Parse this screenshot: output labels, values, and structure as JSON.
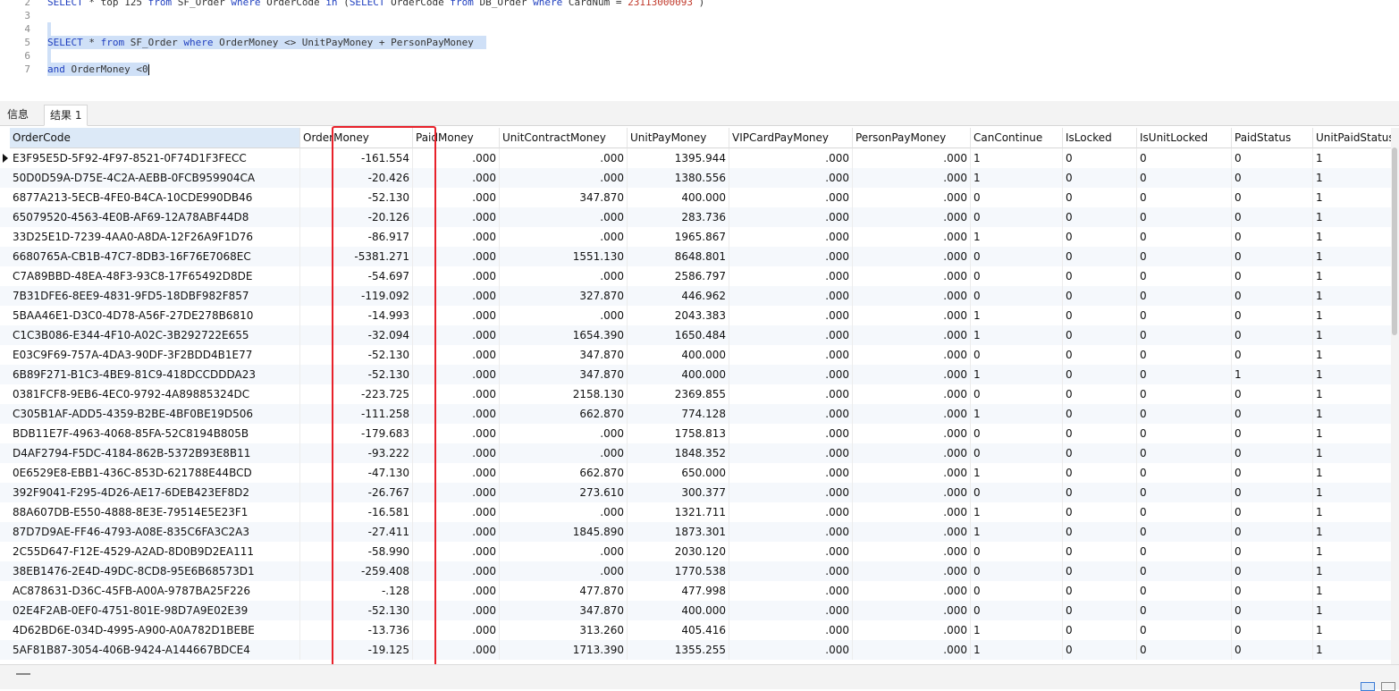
{
  "editor": {
    "lines": [
      {
        "num": "2",
        "tokens": [
          {
            "t": "SELECT ",
            "c": "kw"
          },
          {
            "t": "* top 125 ",
            "c": "plain"
          },
          {
            "t": "from ",
            "c": "kw"
          },
          {
            "t": "SF_Order ",
            "c": "plain"
          },
          {
            "t": "where ",
            "c": "kw"
          },
          {
            "t": "OrderCode ",
            "c": "plain"
          },
          {
            "t": "in ",
            "c": "kw"
          },
          {
            "t": "(",
            "c": "plain"
          },
          {
            "t": "SELECT ",
            "c": "kw"
          },
          {
            "t": "OrderCode ",
            "c": "plain"
          },
          {
            "t": "from ",
            "c": "kw"
          },
          {
            "t": "DB_Order ",
            "c": "plain"
          },
          {
            "t": "where ",
            "c": "kw"
          },
          {
            "t": "CardNum = ",
            "c": "plain"
          },
          {
            "t": "23113000093",
            "c": "num"
          },
          {
            "t": " )",
            "c": "plain"
          }
        ]
      },
      {
        "num": "3",
        "tokens": []
      },
      {
        "num": "4",
        "tokens": [],
        "selected": true
      },
      {
        "num": "5",
        "tokens": [
          {
            "t": "SELECT ",
            "c": "kw"
          },
          {
            "t": "* ",
            "c": "plain"
          },
          {
            "t": "from ",
            "c": "kw"
          },
          {
            "t": "SF_Order ",
            "c": "plain"
          },
          {
            "t": "where ",
            "c": "kw"
          },
          {
            "t": "OrderMoney <> UnitPayMoney + PersonPayMoney",
            "c": "plain"
          }
        ],
        "selected": true
      },
      {
        "num": "6",
        "tokens": [],
        "selected": true
      },
      {
        "num": "7",
        "tokens": [
          {
            "t": "and ",
            "c": "kw"
          },
          {
            "t": "OrderMoney <0",
            "c": "plain"
          }
        ],
        "selected": true,
        "caret": true
      }
    ]
  },
  "tabs": [
    {
      "label": "信息",
      "active": false
    },
    {
      "label": "结果 1",
      "active": true
    }
  ],
  "grid": {
    "columns": [
      "OrderCode",
      "OrderMoney",
      "PaidMoney",
      "UnitContractMoney",
      "UnitPayMoney",
      "VIPCardPayMoney",
      "PersonPayMoney",
      "CanContinue",
      "IsLocked",
      "IsUnitLocked",
      "PaidStatus",
      "UnitPaidStatus"
    ],
    "rows": [
      [
        "E3F95E5D-5F92-4F97-8521-0F74D1F3FECC",
        "-161.554",
        ".000",
        ".000",
        "1395.944",
        ".000",
        ".000",
        "1",
        "0",
        "0",
        "0",
        "1"
      ],
      [
        "50D0D59A-D75E-4C2A-AEBB-0FCB959904CA",
        "-20.426",
        ".000",
        ".000",
        "1380.556",
        ".000",
        ".000",
        "1",
        "0",
        "0",
        "0",
        "1"
      ],
      [
        "6877A213-5ECB-4FE0-B4CA-10CDE990DB46",
        "-52.130",
        ".000",
        "347.870",
        "400.000",
        ".000",
        ".000",
        "0",
        "0",
        "0",
        "0",
        "1"
      ],
      [
        "65079520-4563-4E0B-AF69-12A78ABF44D8",
        "-20.126",
        ".000",
        ".000",
        "283.736",
        ".000",
        ".000",
        "0",
        "0",
        "0",
        "0",
        "1"
      ],
      [
        "33D25E1D-7239-4AA0-A8DA-12F26A9F1D76",
        "-86.917",
        ".000",
        ".000",
        "1965.867",
        ".000",
        ".000",
        "1",
        "0",
        "0",
        "0",
        "1"
      ],
      [
        "6680765A-CB1B-47C7-8DB3-16F76E7068EC",
        "-5381.271",
        ".000",
        "1551.130",
        "8648.801",
        ".000",
        ".000",
        "0",
        "0",
        "0",
        "0",
        "1"
      ],
      [
        "C7A89BBD-48EA-48F3-93C8-17F65492D8DE",
        "-54.697",
        ".000",
        ".000",
        "2586.797",
        ".000",
        ".000",
        "0",
        "0",
        "0",
        "0",
        "1"
      ],
      [
        "7B31DFE6-8EE9-4831-9FD5-18DBF982F857",
        "-119.092",
        ".000",
        "327.870",
        "446.962",
        ".000",
        ".000",
        "0",
        "0",
        "0",
        "0",
        "1"
      ],
      [
        "5BAA46E1-D3C0-4D78-A56F-27DE278B6810",
        "-14.993",
        ".000",
        ".000",
        "2043.383",
        ".000",
        ".000",
        "1",
        "0",
        "0",
        "0",
        "1"
      ],
      [
        "C1C3B086-E344-4F10-A02C-3B292722E655",
        "-32.094",
        ".000",
        "1654.390",
        "1650.484",
        ".000",
        ".000",
        "1",
        "0",
        "0",
        "0",
        "1"
      ],
      [
        "E03C9F69-757A-4DA3-90DF-3F2BDD4B1E77",
        "-52.130",
        ".000",
        "347.870",
        "400.000",
        ".000",
        ".000",
        "0",
        "0",
        "0",
        "0",
        "1"
      ],
      [
        "6B89F271-B1C3-4BE9-81C9-418DCCDDDA23",
        "-52.130",
        ".000",
        "347.870",
        "400.000",
        ".000",
        ".000",
        "1",
        "0",
        "0",
        "1",
        "1"
      ],
      [
        "0381FCF8-9EB6-4EC0-9792-4A89885324DC",
        "-223.725",
        ".000",
        "2158.130",
        "2369.855",
        ".000",
        ".000",
        "0",
        "0",
        "0",
        "0",
        "1"
      ],
      [
        "C305B1AF-ADD5-4359-B2BE-4BF0BE19D506",
        "-111.258",
        ".000",
        "662.870",
        "774.128",
        ".000",
        ".000",
        "1",
        "0",
        "0",
        "0",
        "1"
      ],
      [
        "BDB11E7F-4963-4068-85FA-52C8194B805B",
        "-179.683",
        ".000",
        ".000",
        "1758.813",
        ".000",
        ".000",
        "0",
        "0",
        "0",
        "0",
        "1"
      ],
      [
        "D4AF2794-F5DC-4184-862B-5372B93E8B11",
        "-93.222",
        ".000",
        ".000",
        "1848.352",
        ".000",
        ".000",
        "0",
        "0",
        "0",
        "0",
        "1"
      ],
      [
        "0E6529E8-EBB1-436C-853D-621788E44BCD",
        "-47.130",
        ".000",
        "662.870",
        "650.000",
        ".000",
        ".000",
        "1",
        "0",
        "0",
        "0",
        "1"
      ],
      [
        "392F9041-F295-4D26-AE17-6DEB423EF8D2",
        "-26.767",
        ".000",
        "273.610",
        "300.377",
        ".000",
        ".000",
        "0",
        "0",
        "0",
        "0",
        "1"
      ],
      [
        "88A607DB-E550-4888-8E3E-79514E5E23F1",
        "-16.581",
        ".000",
        ".000",
        "1321.711",
        ".000",
        ".000",
        "1",
        "0",
        "0",
        "0",
        "1"
      ],
      [
        "87D7D9AE-FF46-4793-A08E-835C6FA3C2A3",
        "-27.411",
        ".000",
        "1845.890",
        "1873.301",
        ".000",
        ".000",
        "1",
        "0",
        "0",
        "0",
        "1"
      ],
      [
        "2C55D647-F12E-4529-A2AD-8D0B9D2EA111",
        "-58.990",
        ".000",
        ".000",
        "2030.120",
        ".000",
        ".000",
        "0",
        "0",
        "0",
        "0",
        "1"
      ],
      [
        "38EB1476-2E4D-49DC-8CD8-95E6B68573D1",
        "-259.408",
        ".000",
        ".000",
        "1770.538",
        ".000",
        ".000",
        "0",
        "0",
        "0",
        "0",
        "1"
      ],
      [
        "AC878631-D36C-45FB-A00A-9787BA25F226",
        "-.128",
        ".000",
        "477.870",
        "477.998",
        ".000",
        ".000",
        "0",
        "0",
        "0",
        "0",
        "1"
      ],
      [
        "02E4F2AB-0EF0-4751-801E-98D7A9E02E39",
        "-52.130",
        ".000",
        "347.870",
        "400.000",
        ".000",
        ".000",
        "0",
        "0",
        "0",
        "0",
        "1"
      ],
      [
        "4D62BD6E-034D-4995-A900-A0A782D1BEBE",
        "-13.736",
        ".000",
        "313.260",
        "405.416",
        ".000",
        ".000",
        "1",
        "0",
        "0",
        "0",
        "1"
      ],
      [
        "5AF81B87-3054-406B-9424-A144667BDCE4",
        "-19.125",
        ".000",
        "1713.390",
        "1355.255",
        ".000",
        ".000",
        "1",
        "0",
        "0",
        "0",
        "1"
      ]
    ]
  },
  "colors": {
    "highlight_box": "#e8212a",
    "header_first_cell": "#dce9f7",
    "selection": "#cfe0f7",
    "keyword": "#1f3fbf"
  }
}
